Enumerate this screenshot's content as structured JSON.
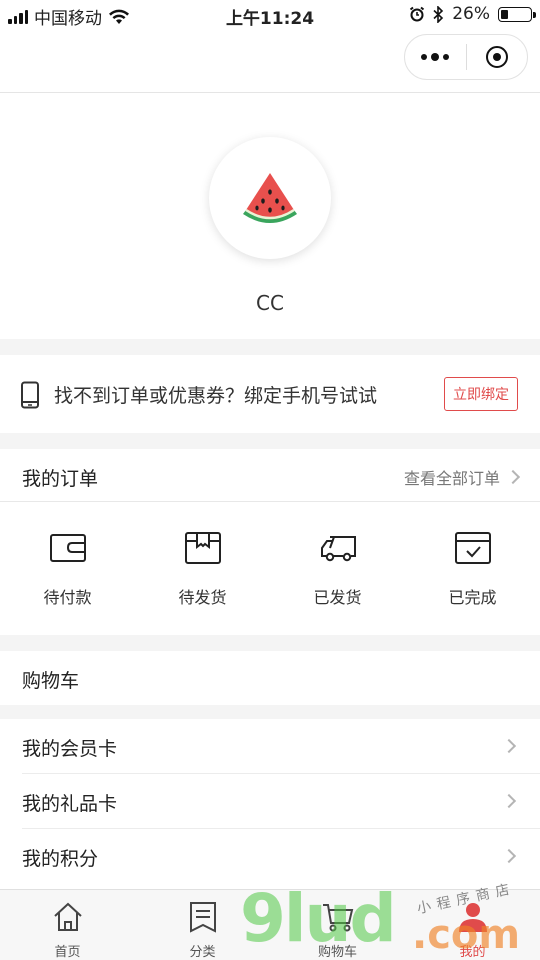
{
  "status_bar": {
    "carrier": "中国移动",
    "time": "上午11:24",
    "battery_text": "26%",
    "battery_level": 0.26
  },
  "profile": {
    "username": "CC",
    "avatar_icon": "watermelon-icon"
  },
  "bind_phone": {
    "message": "找不到订单或优惠券？绑定手机号试试",
    "button_label": "立即绑定",
    "accent": "#e04b4b"
  },
  "orders": {
    "title": "我的订单",
    "view_all_label": "查看全部订单",
    "items": [
      {
        "label": "待付款",
        "icon": "wallet-icon"
      },
      {
        "label": "待发货",
        "icon": "package-icon"
      },
      {
        "label": "已发货",
        "icon": "truck-icon"
      },
      {
        "label": "已完成",
        "icon": "completed-box-icon"
      }
    ]
  },
  "cart_row": {
    "label": "购物车"
  },
  "menu": {
    "items": [
      {
        "label": "我的会员卡"
      },
      {
        "label": "我的礼品卡"
      },
      {
        "label": "我的积分"
      }
    ]
  },
  "tabbar": {
    "items": [
      {
        "label": "首页",
        "icon": "home-icon"
      },
      {
        "label": "分类",
        "icon": "category-icon"
      },
      {
        "label": "购物车",
        "icon": "cart-icon"
      },
      {
        "label": "我的",
        "icon": "user-icon",
        "active": true
      }
    ],
    "active_color": "#e04b4b"
  },
  "watermark": {
    "big": "9lud",
    "com": ".com",
    "small": "小程序商店"
  }
}
